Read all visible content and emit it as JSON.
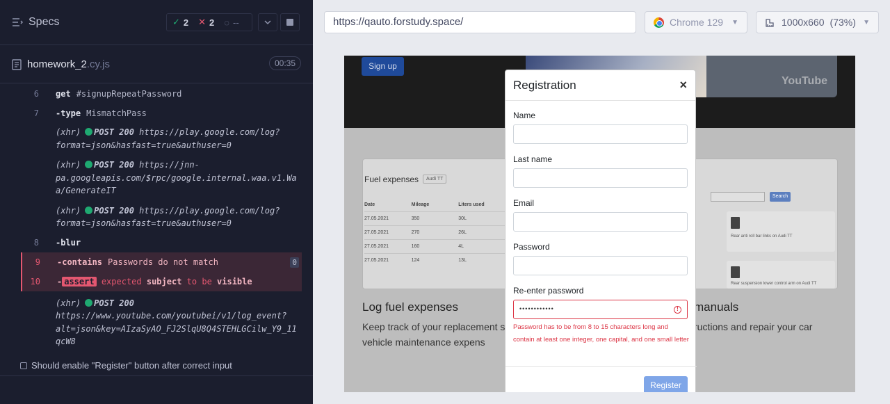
{
  "runner": {
    "specs_label": "Specs",
    "stats": {
      "passed": "2",
      "failed": "2",
      "pending": "--"
    },
    "file": {
      "name": "homework_2",
      "ext": ".cy.js",
      "duration": "00:35"
    },
    "commands": [
      {
        "num": "6",
        "cmd": "get",
        "arg": "#signupRepeatPassword"
      },
      {
        "num": "7",
        "cmd": "-type",
        "arg": "MismatchPass"
      },
      {
        "num": "8",
        "cmd": "-blur",
        "arg": ""
      },
      {
        "num": "9",
        "cmd": "-contains",
        "arg": "Passwords do not match",
        "badge": "0"
      },
      {
        "num": "10",
        "cmd": "-",
        "assert": "assert",
        "arg1": "expected",
        "arg2": "subject",
        "arg3": "to be",
        "arg4": "visible"
      }
    ],
    "xhr": [
      {
        "prefix": "(xhr)",
        "method": "POST 200",
        "url1": "https://play.google.com/log?",
        "url2": "format=json&hasfast=true&authuser=0"
      },
      {
        "prefix": "(xhr)",
        "method": "POST 200",
        "url1": "https://jnn-",
        "url2": "pa.googleapis.com/$rpc/google.internal.waa.v1.Wa",
        "url3": "a/GenerateIT"
      },
      {
        "prefix": "(xhr)",
        "method": "POST 200",
        "url1": "https://play.google.com/log?",
        "url2": "format=json&hasfast=true&authuser=0"
      },
      {
        "prefix": "(xhr)",
        "method": "POST 200",
        "url1": "https://www.youtube.com/youtubei/v1/log_event?",
        "url2": "alt=json&key=AIzaSyAO_FJ2SlqU8Q4STEHLGCilw_Y9_11",
        "url3": "qcW8"
      }
    ],
    "next_test": "Should enable \"Register\" button after correct input"
  },
  "browser": {
    "url": "https://qauto.forstudy.space/",
    "name": "Chrome 129",
    "viewport": "1000x660",
    "zoom": "(73%)"
  },
  "app": {
    "signup": "Sign up",
    "youtube": "YouTube",
    "fuel_title": "Fuel expenses",
    "car": "Audi TT",
    "table_head": [
      "Date",
      "Mileage",
      "Liters used"
    ],
    "table_rows": [
      [
        "27.05.2021",
        "350",
        "30L"
      ],
      [
        "27.05.2021",
        "270",
        "26L"
      ],
      [
        "27.05.2021",
        "160",
        "4L"
      ],
      [
        "27.05.2021",
        "124",
        "13L"
      ]
    ],
    "search": "Search",
    "tile1": "Rear anti roll bar links on Audi TT",
    "tile2": "Rear suspension lower control arm on Audi TT",
    "h_left": "Log fuel expenses",
    "h_right": "manuals",
    "p_left": "Keep track of your replacement s your vehicle maintenance expens",
    "p_right": "ructions and repair your car"
  },
  "modal": {
    "title": "Registration",
    "close": "×",
    "name_label": "Name",
    "lastname_label": "Last name",
    "email_label": "Email",
    "password_label": "Password",
    "repeat_label": "Re-enter password",
    "repeat_value": "••••••••••••",
    "error": "Password has to be from 8 to 15 characters long and contain at least one integer, one capital, and one small letter",
    "register": "Register"
  },
  "colors": {
    "pass": "#1fa971",
    "fail": "#e45770",
    "accent": "#1f4a9a",
    "error": "#dc3545"
  }
}
